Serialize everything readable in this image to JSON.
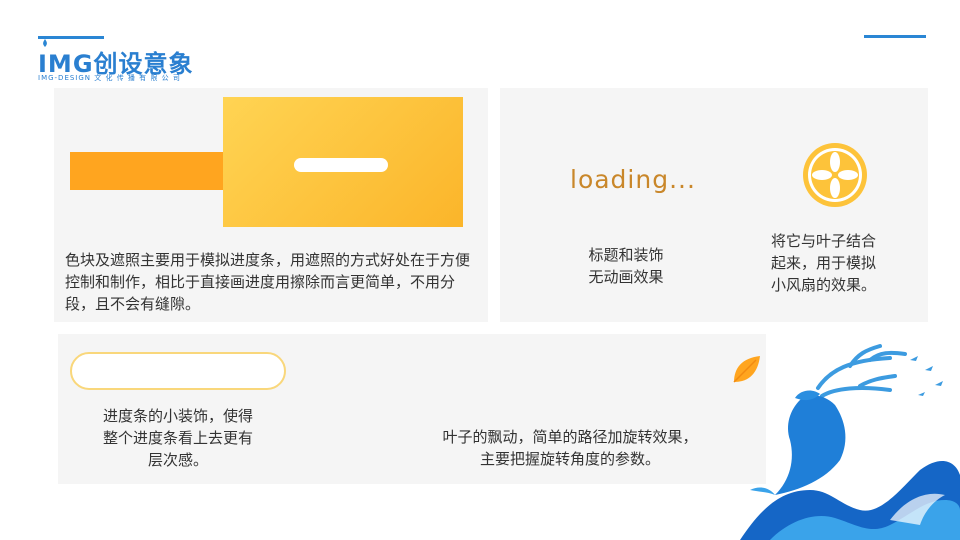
{
  "logo": {
    "name": "IMG创设意象",
    "sub": "IMG-DESIGN 文 化 传 播 有 限 公 司"
  },
  "colors": {
    "accent_blue": "#2a86d4",
    "orange": "#ffa51f",
    "yellow": "#fdc33a",
    "panel_bg": "#f5f5f5"
  },
  "panel1": {
    "text": "色块及遮照主要用于模拟进度条，用遮照的方式好处在于方便控制和制作，相比于直接画进度用擦除而言更简单，不用分段，且不会有缝隙。"
  },
  "panel2": {
    "loading": "loading...",
    "caption_line1": "标题和装饰",
    "caption_line2": "无动画效果",
    "fan_line1": "将它与叶子结合",
    "fan_line2": "起来，用于模拟",
    "fan_line3": "小风扇的效果。"
  },
  "panel3": {
    "deco_line1": "进度条的小装饰，使得",
    "deco_line2": "整个进度条看上去更有",
    "deco_line3": "层次感。",
    "leaf_line1": "叶子的飘动，简单的路径加旋转效果，",
    "leaf_line2": "主要把握旋转角度的参数。"
  }
}
